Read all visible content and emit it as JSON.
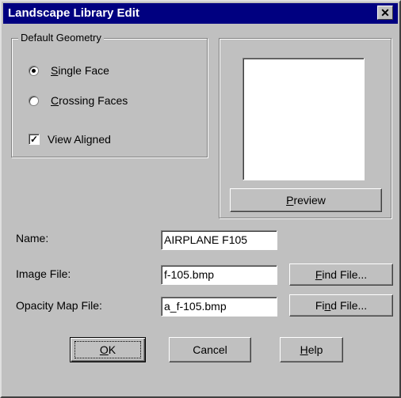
{
  "window": {
    "title": "Landscape Library Edit",
    "close_glyph": "✕"
  },
  "default_geometry": {
    "group_label": "Default Geometry",
    "single_face": {
      "accel": "S",
      "rest": "ingle Face",
      "selected": true
    },
    "crossing_faces": {
      "accel": "C",
      "rest": "rossing Faces",
      "selected": false
    },
    "view_aligned": {
      "label": "View Aligned",
      "checked": true,
      "check_glyph": "✓"
    }
  },
  "preview": {
    "button_accel": "P",
    "button_rest": "review"
  },
  "fields": {
    "name": {
      "label": "Name:",
      "value": "AIRPLANE F105"
    },
    "image_file": {
      "label": "Image File:",
      "value": "f-105.bmp"
    },
    "opacity_map_file": {
      "label": "Opacity Map File:",
      "value": "a_f-105.bmp"
    }
  },
  "find_file_1": {
    "accel": "F",
    "rest": "ind File..."
  },
  "find_file_2": {
    "pre": "Fi",
    "accel": "n",
    "rest": "d File..."
  },
  "buttons": {
    "ok": {
      "accel": "O",
      "rest": "K"
    },
    "cancel": {
      "label": "Cancel"
    },
    "help": {
      "accel": "H",
      "rest": "elp"
    }
  }
}
